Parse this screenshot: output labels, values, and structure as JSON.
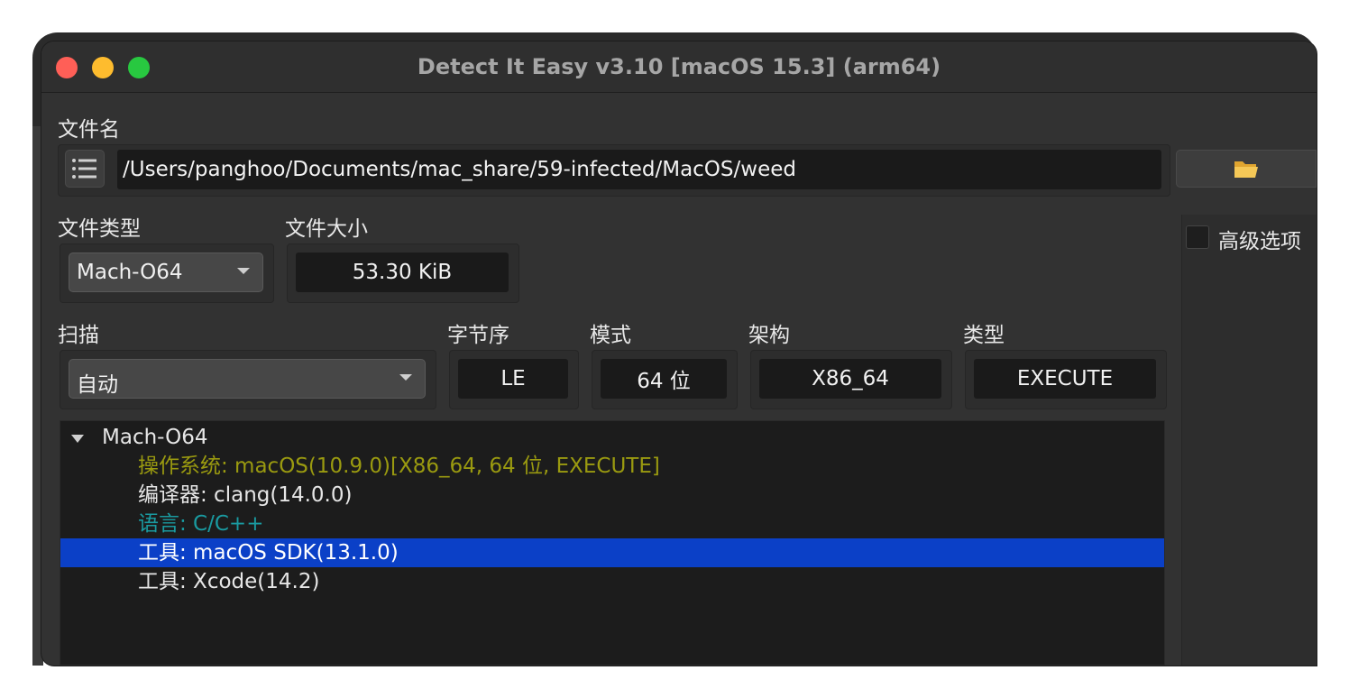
{
  "window": {
    "title": "Detect It Easy v3.10 [macOS 15.3] (arm64)"
  },
  "file": {
    "label": "文件名",
    "path": "/Users/panghoo/Documents/mac_share/59-infected/MacOS/weed",
    "list_icon": "list-icon",
    "open_icon": "folder-icon"
  },
  "file_type": {
    "label": "文件类型",
    "value": "Mach-O64"
  },
  "file_size": {
    "label": "文件大小",
    "value": "53.30 KiB"
  },
  "scan": {
    "label": "扫描",
    "value": "自动"
  },
  "endianness": {
    "label": "字节序",
    "value": "LE"
  },
  "mode": {
    "label": "模式",
    "value": "64 位"
  },
  "arch": {
    "label": "架构",
    "value": "X86_64"
  },
  "type": {
    "label": "类型",
    "value": "EXECUTE"
  },
  "advanced": {
    "label": "高级选项",
    "checked": false
  },
  "results": {
    "root": "Mach-O64",
    "items": [
      {
        "text": "操作系统: macOS(10.9.0)[X86_64, 64 位, EXECUTE]",
        "color": "#9a9a10"
      },
      {
        "text": "编译器: clang(14.0.0)",
        "color": "#e6e6e6"
      },
      {
        "text": "语言: C/C++",
        "color": "#1a9aa0"
      },
      {
        "text": "工具: macOS SDK(13.1.0)",
        "color": "#ffffff",
        "selected": true
      },
      {
        "text": "工具: Xcode(14.2)",
        "color": "#e6e6e6"
      }
    ]
  },
  "colors": {
    "selection": "#0b40c7",
    "window_bg": "#323232"
  }
}
